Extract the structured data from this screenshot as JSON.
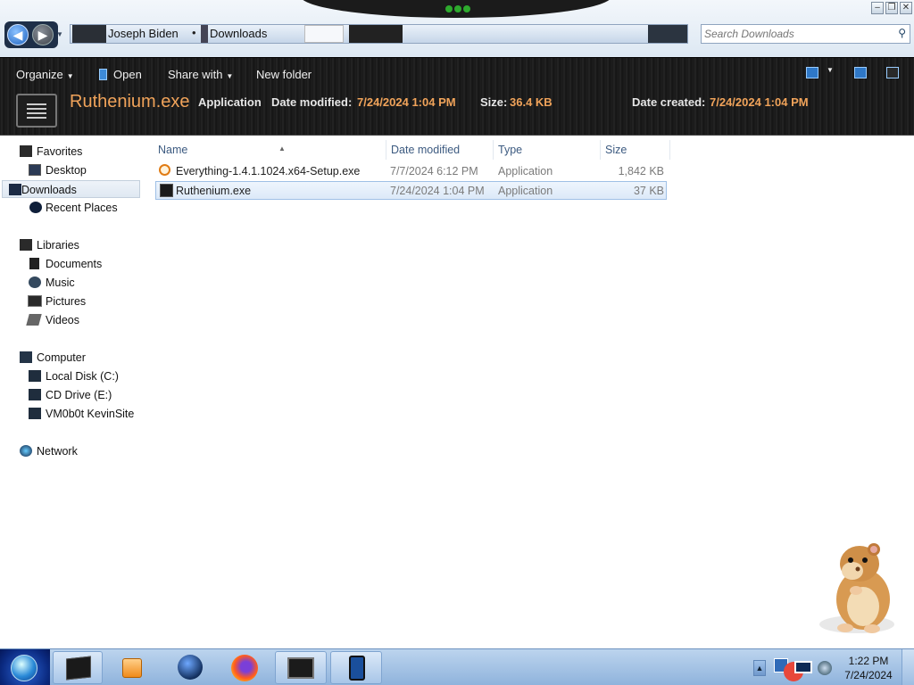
{
  "window": {
    "controls": {
      "minimize": "–",
      "restore": "❐",
      "close": "✕"
    }
  },
  "address_bar": {
    "breadcrumbs": [
      "Joseph Biden",
      "Downloads"
    ],
    "search_placeholder": "Search Downloads"
  },
  "command_bar": {
    "organize": "Organize",
    "open": "Open",
    "share_with": "Share with",
    "new_folder": "New folder"
  },
  "details": {
    "file_name": "Ruthenium.exe",
    "file_type": "Application",
    "date_modified_label": "Date modified:",
    "date_modified_value": "7/24/2024 1:04 PM",
    "size_label": "Size:",
    "size_value": "36.4 KB",
    "date_created_label": "Date created:",
    "date_created_value": "7/24/2024 1:04 PM"
  },
  "nav_pane": {
    "favorites": {
      "header": "Favorites",
      "items": [
        "Desktop",
        "Downloads",
        "Recent Places"
      ]
    },
    "libraries": {
      "header": "Libraries",
      "items": [
        "Documents",
        "Music",
        "Pictures",
        "Videos"
      ]
    },
    "computer": {
      "header": "Computer",
      "items": [
        "Local Disk (C:)",
        "CD Drive (E:)",
        "VM0b0t KevinSite"
      ]
    },
    "network": {
      "header": "Network"
    },
    "selected": "Downloads"
  },
  "file_list": {
    "columns": [
      "Name",
      "Date modified",
      "Type",
      "Size"
    ],
    "rows": [
      {
        "name": "Everything-1.4.1.1024.x64-Setup.exe",
        "date_modified": "7/7/2024 6:12 PM",
        "type": "Application",
        "size": "1,842 KB",
        "icon": "search-installer-icon",
        "selected": false
      },
      {
        "name": "Ruthenium.exe",
        "date_modified": "7/24/2024 1:04 PM",
        "type": "Application",
        "size": "37 KB",
        "icon": "application-icon",
        "selected": true
      }
    ]
  },
  "taskbar": {
    "pinned": [
      "explorer-icon",
      "media-player-icon",
      "globe-icon",
      "firefox-icon",
      "ruthenium-app-icon",
      "phone-app-icon"
    ],
    "clock": {
      "time": "1:22 PM",
      "date": "7/24/2024"
    }
  },
  "colors": {
    "accent_orange": "#f0a35a",
    "selection_blue": "#dce9f8",
    "command_bar": "#1c1c1c",
    "column_header_text": "#3c5a80"
  }
}
